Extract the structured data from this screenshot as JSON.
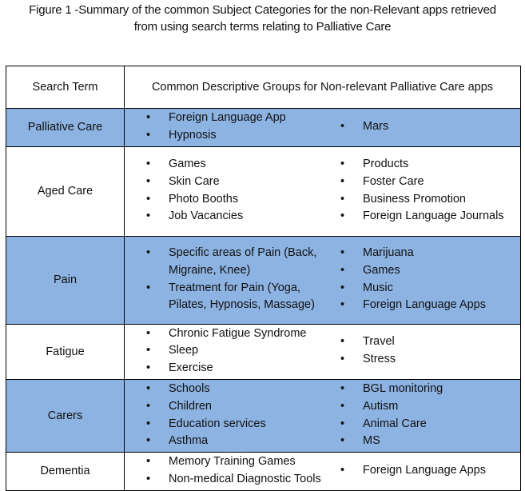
{
  "caption": {
    "line1": "Figure 1 -Summary of the common Subject Categories for the non-Relevant apps retrieved",
    "line2": "from using search terms relating to Palliative Care"
  },
  "table": {
    "headers": [
      "Search Term",
      "Common Descriptive Groups for Non-relevant Palliative Care apps"
    ],
    "background_blue": "#8DB3E2",
    "rows": [
      {
        "term": "Palliative Care",
        "shaded": true,
        "left": [
          "Foreign Language App",
          "Hypnosis"
        ],
        "right": [
          "Mars"
        ]
      },
      {
        "term": "Aged Care",
        "shaded": false,
        "left": [
          "Games",
          "Skin Care",
          "Photo Booths",
          "Job Vacancies"
        ],
        "right": [
          "Products",
          "Foster Care",
          "Business Promotion",
          "Foreign Language Journals"
        ]
      },
      {
        "term": "Pain",
        "shaded": true,
        "left": [
          "Specific areas of Pain (Back, Migraine, Knee)",
          "Treatment for Pain (Yoga, Pilates, Hypnosis, Massage)"
        ],
        "right": [
          "Marijuana",
          "Games",
          "Music",
          "Foreign Language Apps"
        ]
      },
      {
        "term": "Fatigue",
        "shaded": false,
        "left": [
          "Chronic Fatigue Syndrome",
          "Sleep",
          "Exercise"
        ],
        "right": [
          "Travel",
          "Stress"
        ]
      },
      {
        "term": "Carers",
        "shaded": true,
        "left": [
          "Schools",
          "Children",
          "Education services",
          "Asthma"
        ],
        "right": [
          "BGL monitoring",
          "Autism",
          "Animal Care",
          "MS"
        ]
      },
      {
        "term": "Dementia",
        "shaded": false,
        "left": [
          "Memory Training Games",
          "Non-medical Diagnostic Tools"
        ],
        "right": [
          "Foreign Language Apps"
        ]
      }
    ]
  }
}
